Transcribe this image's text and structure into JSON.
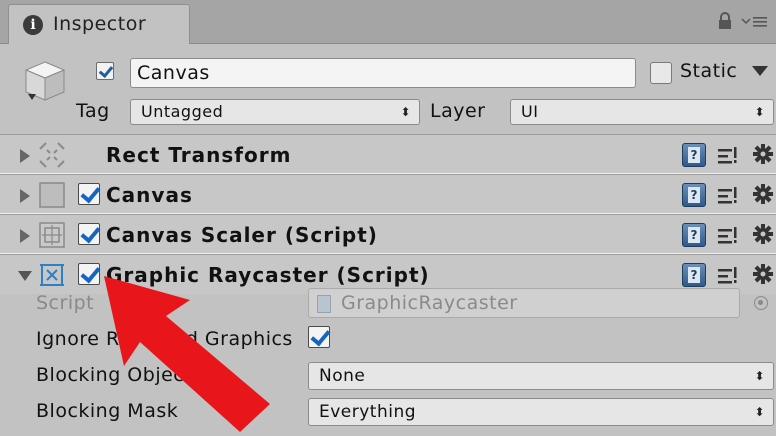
{
  "tab": {
    "title": "Inspector",
    "info_icon": "i"
  },
  "header": {
    "name": "Canvas",
    "static_label": "Static",
    "tag_label": "Tag",
    "tag_value": "Untagged",
    "layer_label": "Layer",
    "layer_value": "UI"
  },
  "components": [
    {
      "title": "Rect Transform",
      "icon": "rect-transform-icon"
    },
    {
      "title": "Canvas",
      "icon": "canvas-icon"
    },
    {
      "title": "Canvas Scaler (Script)",
      "icon": "canvas-scaler-icon"
    },
    {
      "title": "Graphic Raycaster (Script)",
      "icon": "graphic-raycaster-icon"
    }
  ],
  "properties": {
    "script_label": "Script",
    "script_value": "GraphicRaycaster",
    "ignore_label": "Ignore Reversed Graphics",
    "blocking_objects_label": "Blocking Objects",
    "blocking_objects_value": "None",
    "blocking_mask_label": "Blocking Mask",
    "blocking_mask_value": "Everything"
  },
  "arrows_glyph": "⬍",
  "colors": {
    "accent_check": "#1565c0",
    "annotation_arrow": "#e8161b",
    "panel_bg": "#c2c2c2"
  }
}
